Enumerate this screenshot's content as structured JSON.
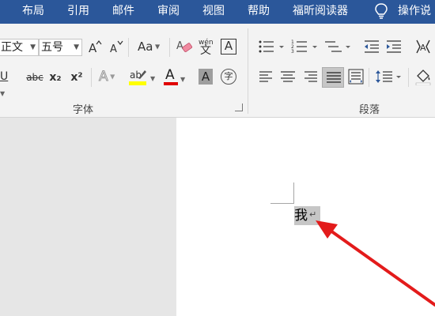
{
  "tabs": [
    {
      "id": "layout",
      "label": "布局"
    },
    {
      "id": "references",
      "label": "引用"
    },
    {
      "id": "mailings",
      "label": "邮件"
    },
    {
      "id": "review",
      "label": "审阅"
    },
    {
      "id": "view",
      "label": "视图"
    },
    {
      "id": "help",
      "label": "帮助"
    },
    {
      "id": "foxit",
      "label": "福昕阅读器"
    }
  ],
  "tell_me": "操作说",
  "font_group": {
    "font_name": "正文",
    "font_size": "五号",
    "label": "字体",
    "aa_label": "Aa",
    "phonetic_top": "wén",
    "phonetic_char": "文",
    "border_char": "A",
    "underline": "U",
    "strike": "abc",
    "subscript": "x₂",
    "superscript": "x²",
    "effects_char": "A",
    "highlight_char": "ab",
    "font_color_char": "A",
    "shading_char": "A",
    "enclose_char": "字"
  },
  "paragraph_group": {
    "label": "段落"
  },
  "document": {
    "text": "我",
    "paragraph_mark": "↵"
  },
  "colors": {
    "tab_bar": "#2b579a",
    "highlight_yellow": "#ffff00",
    "font_red": "#e00000",
    "arrow_red": "#e31b1b"
  }
}
